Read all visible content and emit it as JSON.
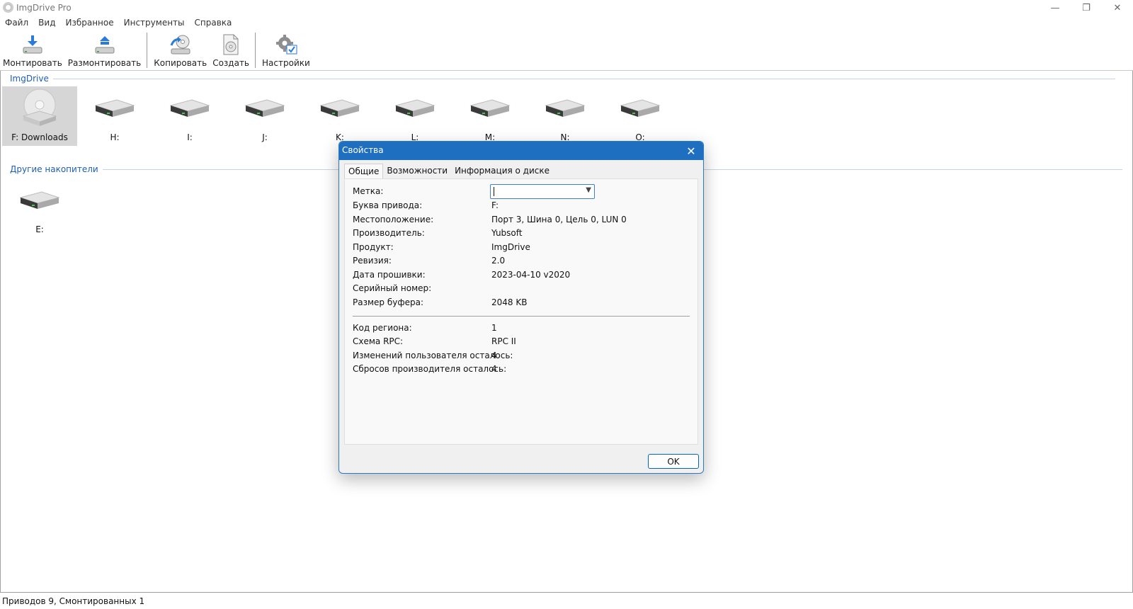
{
  "window": {
    "title": "ImgDrive Pro",
    "controls": {
      "minimize": "—",
      "restore": "❐",
      "close": "✕"
    }
  },
  "menu": [
    "Файл",
    "Вид",
    "Избранное",
    "Инструменты",
    "Справка"
  ],
  "toolbar": {
    "mount": "Монтировать",
    "unmount": "Размонтировать",
    "copy": "Копировать",
    "create": "Создать",
    "settings": "Настройки"
  },
  "groups": {
    "imgdrive": "ImgDrive",
    "other": "Другие накопители"
  },
  "drives": [
    {
      "label": "F: Downloads",
      "icon": "optical-disc-icon",
      "selected": true
    },
    {
      "label": "H:",
      "icon": "drive-icon"
    },
    {
      "label": "I:",
      "icon": "drive-icon"
    },
    {
      "label": "J:",
      "icon": "drive-icon"
    },
    {
      "label": "K:",
      "icon": "drive-icon"
    },
    {
      "label": "L:",
      "icon": "drive-icon"
    },
    {
      "label": "M:",
      "icon": "drive-icon"
    },
    {
      "label": "N:",
      "icon": "drive-icon"
    },
    {
      "label": "O:",
      "icon": "drive-icon"
    }
  ],
  "other_drives": [
    {
      "label": "E:",
      "icon": "drive-icon"
    }
  ],
  "status": "Приводов 9, Смонтированных 1",
  "dialog": {
    "title": "Свойства",
    "close": "✕",
    "tabs": [
      "Общие",
      "Возможности",
      "Информация о диске"
    ],
    "label_field": {
      "label": "Метка:",
      "value": ""
    },
    "props": [
      {
        "label": "Буква привода:",
        "value": "F:"
      },
      {
        "label": "Местоположение:",
        "value": "Порт 3, Шина 0, Цель 0, LUN 0"
      },
      {
        "label": "Производитель:",
        "value": "Yubsoft"
      },
      {
        "label": "Продукт:",
        "value": "ImgDrive"
      },
      {
        "label": "Ревизия:",
        "value": "2.0"
      },
      {
        "label": "Дата прошивки:",
        "value": "2023-04-10 v2020"
      },
      {
        "label": "Серийный номер:",
        "value": ""
      },
      {
        "label": "Размер буфера:",
        "value": "2048 KB"
      }
    ],
    "props2": [
      {
        "label": "Код региона:",
        "value": "1"
      },
      {
        "label": "Схема RPC:",
        "value": "RPC II"
      },
      {
        "label": "Изменений пользователя осталось:",
        "value": "4"
      },
      {
        "label": "Сбросов производителя осталось:",
        "value": "4"
      }
    ],
    "ok": "OK"
  },
  "colors": {
    "accent": "#1f6fc0",
    "group_header": "#1f5fae",
    "selection": "#d6d6d6"
  }
}
